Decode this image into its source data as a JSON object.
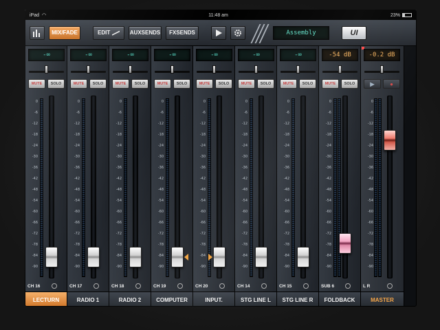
{
  "status_bar": {
    "device": "iPad",
    "wifi_icon": "wifi-icon",
    "time": "11:48 am",
    "battery": "23%"
  },
  "toolbar": {
    "eq_icon": "equalizer-icon",
    "mix_fade_label": "MIX/FADE",
    "edit_label": "EDIT",
    "aux_sends_label": "AUXSENDS",
    "fx_sends_label": "FXSENDS",
    "play_icon": "play-icon",
    "settings_icon": "gear-icon",
    "scene_name": "Assembly",
    "logo": "UI"
  },
  "channels": [
    {
      "number": "CH 16",
      "name": "LECTURN",
      "level": "-∞",
      "mute": "MUTE",
      "solo": "SOLO",
      "selected": true,
      "fader": 0.0
    },
    {
      "number": "CH 17",
      "name": "RADIO 1",
      "level": "-∞",
      "mute": "MUTE",
      "solo": "SOLO",
      "selected": false,
      "fader": 0.0
    },
    {
      "number": "CH 18",
      "name": "RADIO 2",
      "level": "-∞",
      "mute": "MUTE",
      "solo": "SOLO",
      "selected": false,
      "fader": 0.0
    },
    {
      "number": "CH 19",
      "name": "COMPUTER",
      "level": "-∞",
      "mute": "MUTE",
      "solo": "SOLO",
      "selected": false,
      "fader": 0.0
    },
    {
      "number": "CH 20",
      "name": "INPUT.",
      "level": "-∞",
      "mute": "MUTE",
      "solo": "SOLO",
      "selected": false,
      "fader": 0.0
    },
    {
      "number": "CH 14",
      "name": "STG LINE L",
      "level": "-∞",
      "mute": "MUTE",
      "solo": "SOLO",
      "selected": false,
      "fader": 0.0
    },
    {
      "number": "CH 15",
      "name": "STG LINE R",
      "level": "-∞",
      "mute": "MUTE",
      "solo": "SOLO",
      "selected": false,
      "fader": 0.0
    },
    {
      "number": "SUB 6",
      "name": "FOLDBACK",
      "level": "-54 dB",
      "mute": "MUTE",
      "solo": "SOLO",
      "selected": false,
      "fader": 0.0
    }
  ],
  "master": {
    "name": "MASTER",
    "level": "-0.2 dB",
    "meter_labels": "L   R",
    "play_icon": "play-icon",
    "record_icon": "record-icon"
  },
  "scale_ticks": [
    "0",
    "-6",
    "-12",
    "-18",
    "-24",
    "-30",
    "-36",
    "-42",
    "-48",
    "-54",
    "-60",
    "-66",
    "-72",
    "-78",
    "-84",
    "-90"
  ],
  "colors": {
    "accent": "#e8913e",
    "display_text": "#55d8c2",
    "mute_red": "#c43c3c"
  }
}
